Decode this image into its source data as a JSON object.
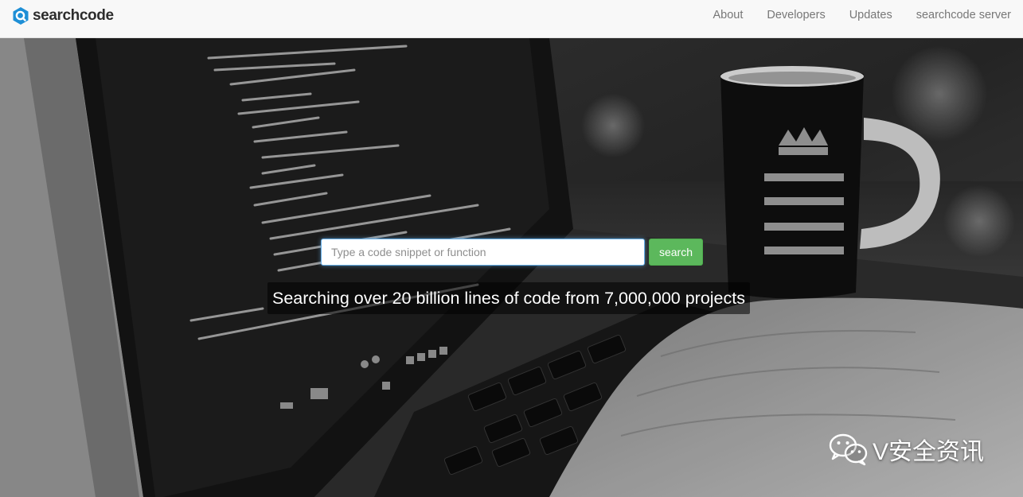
{
  "brand": {
    "name": "searchcode",
    "logo_icon": "searchcode-logo-icon"
  },
  "nav": {
    "items": [
      {
        "label": "About"
      },
      {
        "label": "Developers"
      },
      {
        "label": "Updates"
      },
      {
        "label": "searchcode server"
      }
    ]
  },
  "search": {
    "placeholder": "Type a code snippet or function",
    "value": "",
    "button_label": "search"
  },
  "tagline": "Searching over 20 billion lines of code from 7,000,000 projects",
  "watermark": {
    "text": "V安全资讯",
    "icon": "wechat-icon"
  },
  "colors": {
    "navbar_bg": "#f8f8f8",
    "brand_accent": "#1e8fd6",
    "search_button": "#5cb85c",
    "input_focus_border": "#66afe9"
  }
}
